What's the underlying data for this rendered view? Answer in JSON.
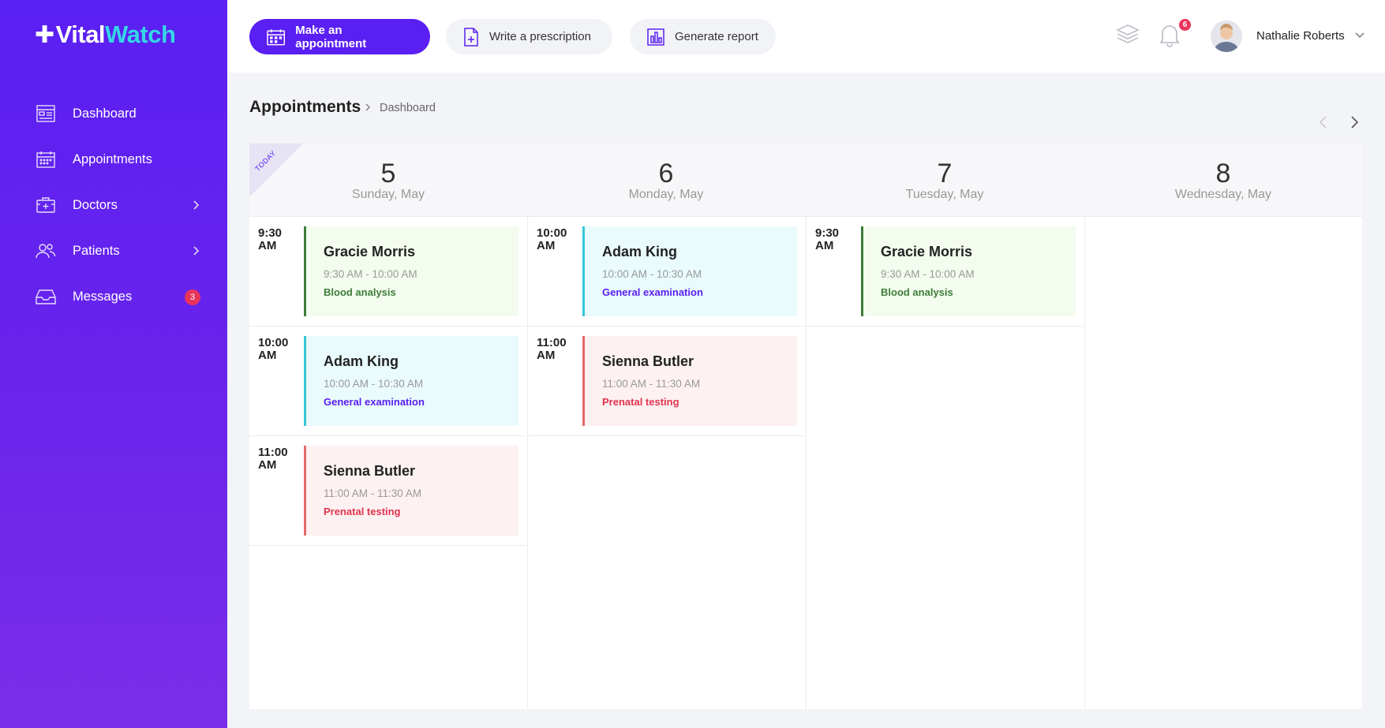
{
  "brand": {
    "prefix": "Vital",
    "suffix": "Watch"
  },
  "sidebar": {
    "items": [
      {
        "label": "Dashboard",
        "icon": "dashboard-icon"
      },
      {
        "label": "Appointments",
        "icon": "calendar-icon"
      },
      {
        "label": "Doctors",
        "icon": "briefcase-medical-icon",
        "has_submenu": true
      },
      {
        "label": "Patients",
        "icon": "users-icon",
        "has_submenu": true
      },
      {
        "label": "Messages",
        "icon": "inbox-icon",
        "badge": "3"
      }
    ]
  },
  "toolbar": {
    "make_appointment": "Make an appointment",
    "write_prescription": "Write a prescription",
    "generate_report": "Generate report"
  },
  "user": {
    "name": "Nathalie Roberts",
    "notifications": "6"
  },
  "breadcrumb": {
    "title": "Appointments",
    "current": "Dashboard"
  },
  "calendar": {
    "today_label": "TODAY",
    "days": [
      {
        "num": "5",
        "label": "Sunday, May"
      },
      {
        "num": "6",
        "label": "Monday, May"
      },
      {
        "num": "7",
        "label": "Tuesday, May"
      },
      {
        "num": "8",
        "label": "Wednesday, May"
      }
    ],
    "appointments": [
      {
        "time_line1": "9:30",
        "time_line2": "AM",
        "name": "Gracie Morris",
        "range": "9:30 AM - 10:00 AM",
        "type": "Blood analysis"
      },
      {
        "time_line1": "10:00",
        "time_line2": "AM",
        "name": "Adam King",
        "range": "10:00 AM - 10:30 AM",
        "type": "General examination"
      },
      {
        "time_line1": "11:00",
        "time_line2": "AM",
        "name": "Sienna Butler",
        "range": "11:00 AM - 11:30 AM",
        "type": "Prenatal testing"
      },
      {
        "time_line1": "10:00",
        "time_line2": "AM",
        "name": "Adam King",
        "range": "10:00 AM - 10:30 AM",
        "type": "General examination"
      },
      {
        "time_line1": "11:00",
        "time_line2": "AM",
        "name": "Sienna Butler",
        "range": "11:00 AM - 11:30 AM",
        "type": "Prenatal testing"
      },
      {
        "time_line1": "9:30",
        "time_line2": "AM",
        "name": "Gracie Morris",
        "range": "9:30 AM - 10:00 AM",
        "type": "Blood analysis"
      }
    ]
  },
  "colors": {
    "primary": "#5a1ff2",
    "accent": "#35d6e6",
    "badge": "#e8345a",
    "blood_bg": "#f3fcee",
    "blood_border": "#3e7d3a",
    "blood_text": "#3e7d3a",
    "exam_bg": "#e9fbfc",
    "exam_border": "#38c6d8",
    "exam_text": "#5a1ff2",
    "prenatal_bg": "#fdf1f1",
    "prenatal_border": "#e36a6a",
    "prenatal_text": "#e0344f"
  }
}
